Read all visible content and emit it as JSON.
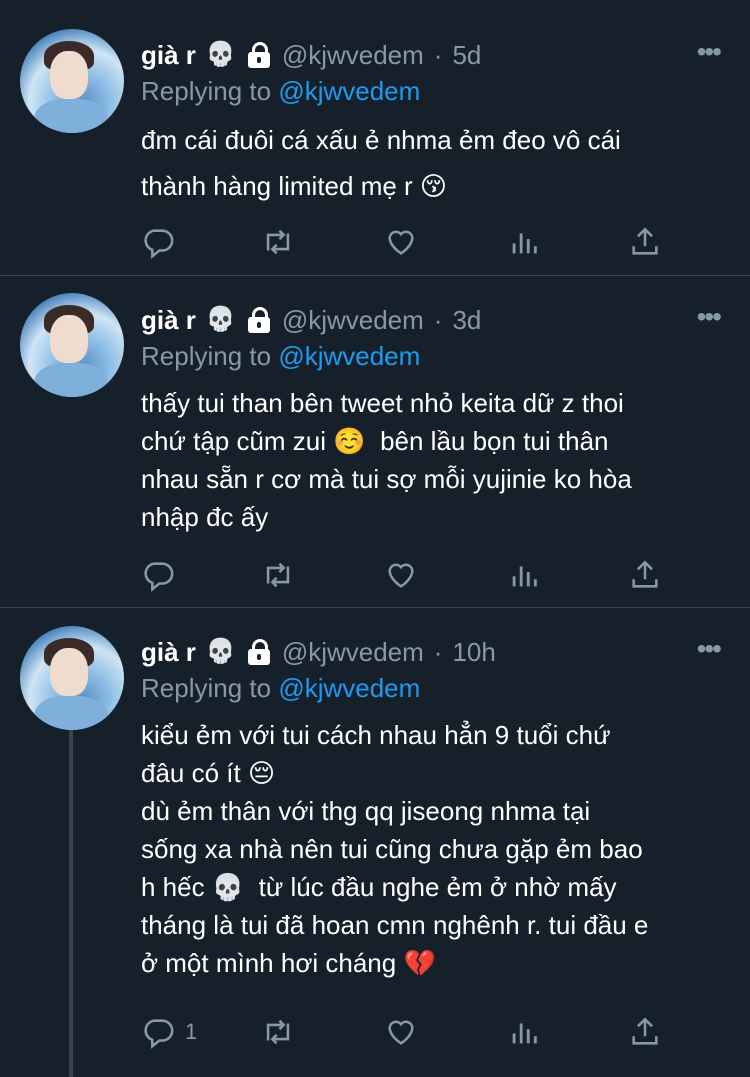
{
  "tweets": [
    {
      "name": "già r",
      "name_emoji": "💀",
      "handle": "@kjwvedem",
      "time": "5d",
      "replying_prefix": "Replying to",
      "replying_to": "@kjwvedem",
      "text": "đm cái đuôi cá xấu ẻ nhma ẻm đeo vô cái\nthành hàng limited mẹ r 😚",
      "reply_count": "",
      "retweet_count": "",
      "like_count": ""
    },
    {
      "name": "già r",
      "name_emoji": "💀",
      "handle": "@kjwvedem",
      "time": "3d",
      "replying_prefix": "Replying to",
      "replying_to": "@kjwvedem",
      "text": "thấy tui than bên tweet nhỏ keita dữ z thoi\nchứ tập cũm zui ☺️  bên lầu bọn tui thân\nnhau sẵn r cơ mà tui sợ mỗi yujinie ko hòa\nnhập đc ấy",
      "reply_count": "",
      "retweet_count": "",
      "like_count": ""
    },
    {
      "name": "già r",
      "name_emoji": "💀",
      "handle": "@kjwvedem",
      "time": "10h",
      "replying_prefix": "Replying to",
      "replying_to": "@kjwvedem",
      "text": "kiểu ẻm với tui cách nhau hẳn 9 tuổi chứ\nđâu có ít 😔\ndù ẻm thân với thg qq jiseong nhma tại\nsống xa nhà nên tui cũng chưa gặp ẻm bao\nh hếc 💀  từ lúc đầu nghe ẻm ở nhờ mấy\ntháng là tui đã hoan cmn nghênh r. tui đầu e\nở một mình hơi cháng 💔",
      "reply_count": "1",
      "retweet_count": "",
      "like_count": ""
    }
  ],
  "separator": "·",
  "colors": {
    "background": "#15202b",
    "secondary_text": "#8899a6",
    "link": "#1d9bf0",
    "divider": "#38444d"
  },
  "icons": [
    "reply-icon",
    "retweet-icon",
    "like-icon",
    "analytics-icon",
    "share-icon",
    "more-icon",
    "lock-icon"
  ]
}
